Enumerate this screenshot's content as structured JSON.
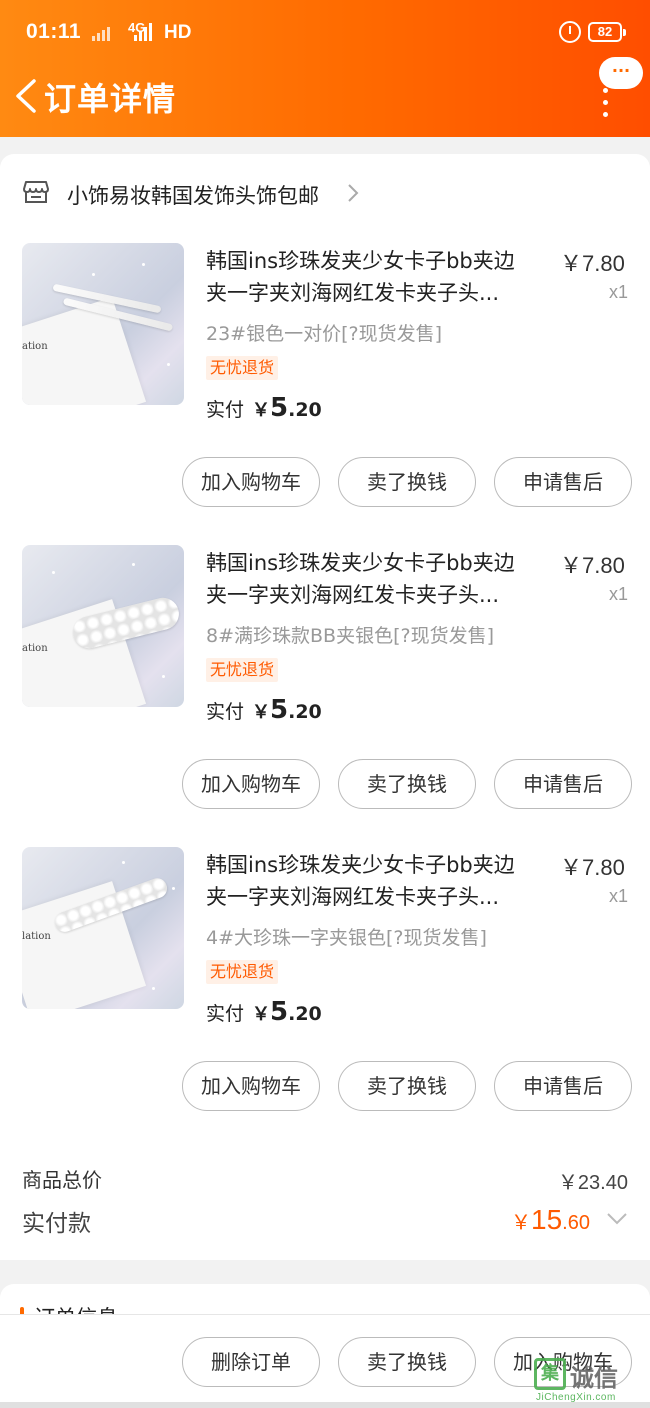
{
  "status_bar": {
    "time": "01:11",
    "signal_label": "4G",
    "network_label": "HD",
    "battery": "82"
  },
  "header": {
    "title": "订单详情",
    "more_label": "···",
    "background_start": "#ff8a12",
    "background_end": "#ff4e00"
  },
  "shop": {
    "name": "小饰易妆韩国发饰头饰包邮"
  },
  "items": [
    {
      "title_line1": "韩国ins珍珠发夹少女卡子bb夹边",
      "title_line2": "夹一字夹刘海网红发卡夹子头...",
      "price": "￥7.80",
      "quantity": "x1",
      "sku": "23#银色一对价[?现货发售]",
      "tag": "无忧退货",
      "paid_label": "实付",
      "paid_currency": "￥",
      "paid_integer": "5",
      "paid_decimal": ".20",
      "thumb_caption": "ation",
      "buttons": [
        "加入购物车",
        "卖了换钱",
        "申请售后"
      ]
    },
    {
      "title_line1": "韩国ins珍珠发夹少女卡子bb夹边",
      "title_line2": "夹一字夹刘海网红发卡夹子头...",
      "price": "￥7.80",
      "quantity": "x1",
      "sku": "8#满珍珠款BB夹银色[?现货发售]",
      "tag": "无忧退货",
      "paid_label": "实付",
      "paid_currency": "￥",
      "paid_integer": "5",
      "paid_decimal": ".20",
      "thumb_caption": "ation",
      "buttons": [
        "加入购物车",
        "卖了换钱",
        "申请售后"
      ]
    },
    {
      "title_line1": "韩国ins珍珠发夹少女卡子bb夹边",
      "title_line2": "夹一字夹刘海网红发卡夹子头...",
      "price": "￥7.80",
      "quantity": "x1",
      "sku": "4#大珍珠一字夹银色[?现货发售]",
      "tag": "无忧退货",
      "paid_label": "实付",
      "paid_currency": "￥",
      "paid_integer": "5",
      "paid_decimal": ".20",
      "thumb_caption": "lation",
      "buttons": [
        "加入购物车",
        "卖了换钱",
        "申请售后"
      ]
    }
  ],
  "summary": {
    "goods_total_label": "商品总价",
    "goods_total_value": "￥23.40",
    "paid_label": "实付款",
    "paid_currency": "￥",
    "paid_integer": "15",
    "paid_decimal": ".60",
    "accent_color": "#ff5a00"
  },
  "order_info": {
    "title": "订单信息"
  },
  "bottom_bar": {
    "buttons": [
      "删除订单",
      "卖了换钱",
      "加入购物车"
    ]
  },
  "watermark": {
    "box_char": "集",
    "text": "诚信",
    "url": "JiChengXin.com"
  }
}
